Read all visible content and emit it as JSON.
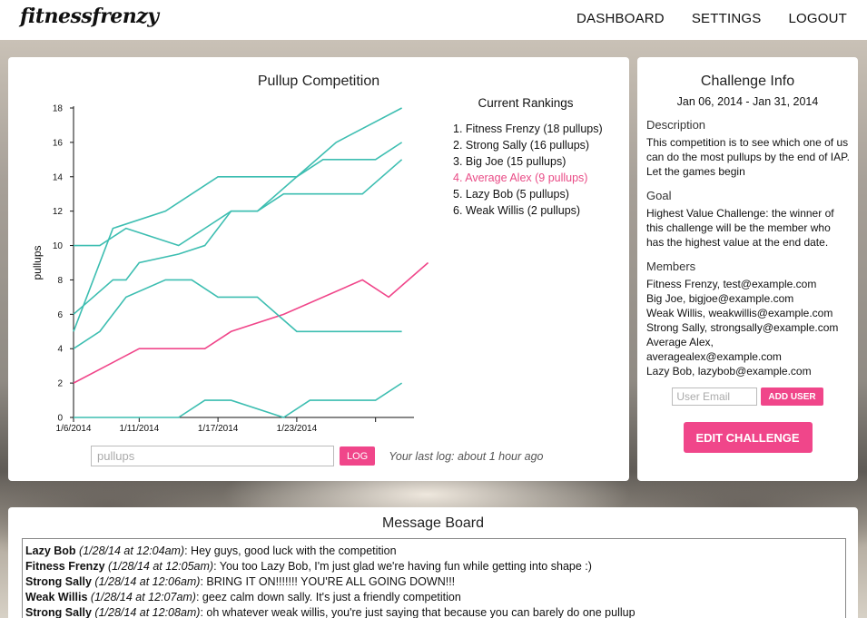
{
  "header": {
    "logo": "fitnessfrenzy",
    "nav": [
      "DASHBOARD",
      "SETTINGS",
      "LOGOUT"
    ]
  },
  "chart_panel": {
    "title": "Pullup Competition",
    "rankings_title": "Current Rankings",
    "rankings": [
      "1. Fitness Frenzy (18 pullups)",
      "2. Strong Sally (16 pullups)",
      "3. Big Joe (15 pullups)",
      "4. Average Alex (9 pullups)",
      "5. Lazy Bob (5 pullups)",
      "6. Weak Willis (2 pullups)"
    ],
    "highlight_index": 3,
    "log_placeholder": "pullups",
    "log_button": "LOG",
    "last_log": "Your last log: about 1 hour ago"
  },
  "chart_data": {
    "type": "line",
    "ylabel": "pullups",
    "ylim": [
      0,
      18
    ],
    "yticks": [
      0,
      2,
      4,
      6,
      8,
      10,
      12,
      14,
      16,
      18
    ],
    "xlabels": [
      "1/6/2014",
      "1/11/2014",
      "1/17/2014",
      "1/23/2014"
    ],
    "xlabel_days": [
      6,
      11,
      17,
      23
    ],
    "xlim_days": [
      6,
      31
    ],
    "extra_tick_day": 29,
    "colors": {
      "teal": "#3dbeb1",
      "pink": "#f0468a"
    },
    "series": [
      {
        "color": "teal",
        "points": [
          [
            6,
            5
          ],
          [
            9,
            11
          ],
          [
            13,
            12
          ],
          [
            17,
            14
          ],
          [
            23,
            14
          ],
          [
            26,
            16
          ],
          [
            31,
            18
          ]
        ]
      },
      {
        "color": "teal",
        "points": [
          [
            6,
            10
          ],
          [
            8,
            10
          ],
          [
            10,
            11
          ],
          [
            14,
            10
          ],
          [
            16,
            11
          ],
          [
            18,
            12
          ],
          [
            20,
            12
          ],
          [
            23,
            14
          ],
          [
            25,
            15
          ],
          [
            29,
            15
          ],
          [
            31,
            16
          ]
        ]
      },
      {
        "color": "teal",
        "points": [
          [
            6,
            6
          ],
          [
            9,
            8
          ],
          [
            10,
            8
          ],
          [
            11,
            9
          ],
          [
            14,
            9.5
          ],
          [
            16,
            10
          ],
          [
            18,
            12
          ],
          [
            20,
            12
          ],
          [
            22,
            13
          ],
          [
            25,
            13
          ],
          [
            28,
            13
          ],
          [
            31,
            15
          ]
        ]
      },
      {
        "color": "pink",
        "points": [
          [
            6,
            2
          ],
          [
            11,
            4
          ],
          [
            16,
            4
          ],
          [
            18,
            5
          ],
          [
            22,
            6
          ],
          [
            28,
            8
          ],
          [
            30,
            7
          ],
          [
            33,
            9
          ]
        ]
      },
      {
        "color": "teal",
        "points": [
          [
            6,
            4
          ],
          [
            8,
            5
          ],
          [
            10,
            7
          ],
          [
            13,
            8
          ],
          [
            15,
            8
          ],
          [
            17,
            7
          ],
          [
            20,
            7
          ],
          [
            23,
            5
          ],
          [
            25,
            5
          ],
          [
            31,
            5
          ]
        ]
      },
      {
        "color": "teal",
        "points": [
          [
            6,
            0
          ],
          [
            14,
            0
          ],
          [
            16,
            1
          ],
          [
            18,
            1
          ],
          [
            22,
            0
          ],
          [
            24,
            1
          ],
          [
            29,
            1
          ],
          [
            31,
            2
          ]
        ]
      }
    ]
  },
  "challenge": {
    "title": "Challenge Info",
    "dates": "Jan 06, 2014 - Jan 31, 2014",
    "description_label": "Description",
    "description": "This competition is to see which one of us can do the most pullups by the end of IAP. Let the games begin",
    "goal_label": "Goal",
    "goal": "Highest Value Challenge: the winner of this challenge will be the member who has the highest value at the end date.",
    "members_label": "Members",
    "members": [
      "Fitness Frenzy, test@example.com",
      "Big Joe, bigjoe@example.com",
      "Weak Willis, weakwillis@example.com",
      "Strong Sally, strongsally@example.com",
      "Average Alex, averagealex@example.com",
      "Lazy Bob, lazybob@example.com"
    ],
    "email_placeholder": "User Email",
    "add_user_button": "ADD USER",
    "edit_button": "EDIT CHALLENGE"
  },
  "board": {
    "title": "Message Board",
    "messages": [
      {
        "who": "Lazy Bob",
        "when": "(1/28/14 at 12:04am)",
        "text": ": Hey guys, good luck with the competition"
      },
      {
        "who": "Fitness Frenzy",
        "when": "(1/28/14 at 12:05am)",
        "text": ": You too Lazy Bob, I'm just glad we're having fun while getting into shape :)"
      },
      {
        "who": "Strong Sally",
        "when": "(1/28/14 at 12:06am)",
        "text": ": BRING IT ON!!!!!!! YOU'RE ALL GOING DOWN!!!"
      },
      {
        "who": "Weak Willis",
        "when": "(1/28/14 at 12:07am)",
        "text": ": geez calm down sally. It's just a friendly competition"
      },
      {
        "who": "Strong Sally",
        "when": "(1/28/14 at 12:08am)",
        "text": ": oh whatever weak willis, you're just saying that because you can barely do one pullup"
      }
    ]
  }
}
